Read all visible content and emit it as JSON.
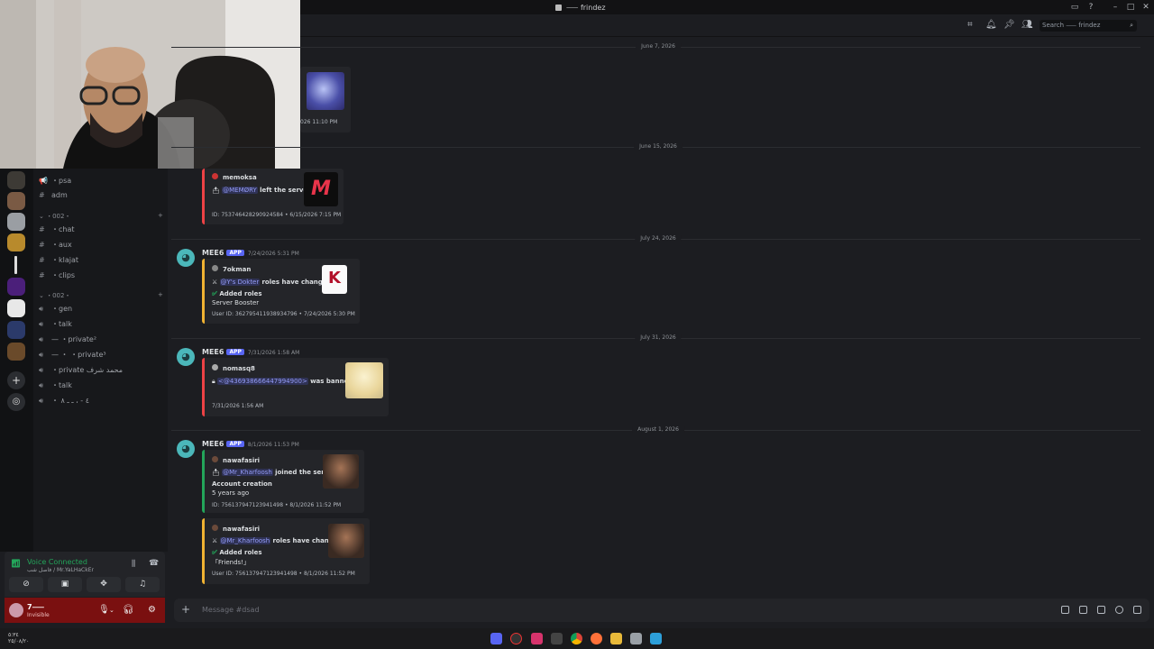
{
  "window": {
    "title": "⸺ frindez"
  },
  "header": {
    "search_placeholder": "Search ⸺ frindez"
  },
  "channels": {
    "top": [
      {
        "icon": "📢",
        "label": "・psa"
      },
      {
        "icon": "#",
        "label": "adm"
      }
    ],
    "cat1": "・002・",
    "text": [
      {
        "label": "・chat"
      },
      {
        "label": "・aux"
      },
      {
        "label": "・klajat"
      },
      {
        "label": "・clips"
      }
    ],
    "cat2": "・002・",
    "voice": [
      {
        "label": "・gen"
      },
      {
        "label": "・talk"
      },
      {
        "label": "— ・private²"
      },
      {
        "label": "— ・ ・private³"
      },
      {
        "label": "・private محمد شرف"
      },
      {
        "label": "・talk"
      },
      {
        "label": "・ ٤ - ، ـ ـ ٨"
      }
    ]
  },
  "dates": [
    "June 7, 2026",
    "June 15, 2026",
    "July 24, 2026",
    "July 31, 2026",
    "August 1, 2026"
  ],
  "msg0": {
    "ts": "026 11:10 PM"
  },
  "msg1": {
    "user": "memoksa",
    "mention": "@MEMØRY",
    "action": "left the server",
    "footer": "ID: 753746428290924584 • 6/15/2026 7:15 PM"
  },
  "msg2": {
    "author": "MEE6",
    "badge": "APP",
    "ts": "7/24/2026 5:31 PM",
    "user": "7okman",
    "mention": "@Y's Dokter",
    "action": "roles have changed",
    "added": "Added roles",
    "role": "Server Booster",
    "footer": "User ID: 362795411938934796 • 7/24/2026 5:30 PM"
  },
  "msg3": {
    "author": "MEE6",
    "badge": "APP",
    "ts": "7/31/2026 1:58 AM",
    "user": "nomasq8",
    "mention": "<@436938666447994900>",
    "action": "was banned",
    "footer": "7/31/2026 1:56 AM"
  },
  "msg4": {
    "author": "MEE6",
    "badge": "APP",
    "ts": "8/1/2026 11:53 PM",
    "user": "nawafasiri",
    "mention": "@Mr_Kharfoosh",
    "action": "joined the server",
    "line2": "Account creation",
    "line3": "5 years ago",
    "footer": "ID: 756137947123941498 • 8/1/2026 11:52 PM"
  },
  "msg5": {
    "user": "nawafasiri",
    "mention": "@Mr_Kharfoosh",
    "action": "roles have changed",
    "added": "Added roles",
    "role": "「Friends!」",
    "footer": "User ID: 756137947123941498 • 8/1/2026 11:52 PM"
  },
  "composer": {
    "placeholder": "Message #dsad"
  },
  "voice": {
    "status": "Voice Connected",
    "sub": "فاصل شب / Mr.YaLHaCkEr"
  },
  "user": {
    "name": "7⸺",
    "status": "Invisible"
  },
  "clock": {
    "time": "٥:٣٤",
    "date": "٢٥/٠٨/٢٠"
  },
  "colors": {
    "accent": "#5865f2",
    "voice": "#23a55a",
    "userbar": "#7a1010",
    "mee6": "#4bb7ba"
  }
}
